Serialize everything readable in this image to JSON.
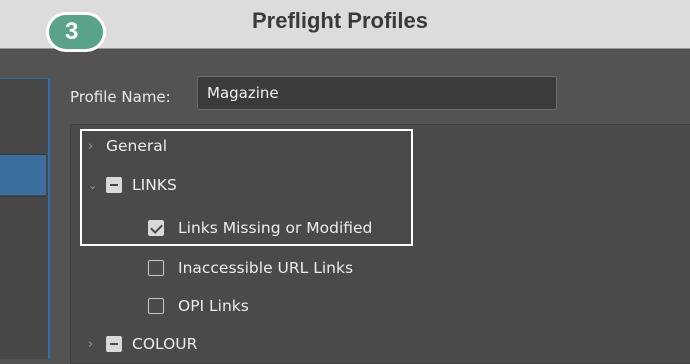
{
  "window": {
    "title": "Preflight Profiles"
  },
  "badge": {
    "number": "3"
  },
  "profile": {
    "name_label": "Profile Name:",
    "name_value": "Magazine"
  },
  "tree": {
    "general": {
      "label": "General",
      "chevron": "chevron-right-icon"
    },
    "links": {
      "label": "LINKS",
      "chevron": "chevron-down-icon",
      "state": "mixed"
    },
    "links_missing": {
      "label": "Links Missing or Modified",
      "checked": true
    },
    "inaccessible_url": {
      "label": "Inaccessible URL Links",
      "checked": false
    },
    "opi_links": {
      "label": "OPI Links",
      "checked": false
    },
    "colour": {
      "label": "COLOUR",
      "chevron": "chevron-right-icon",
      "state": "mixed"
    }
  },
  "colors": {
    "badge": "#5aa38a",
    "highlight": "#ffffff",
    "selection": "#3b6f9f"
  }
}
